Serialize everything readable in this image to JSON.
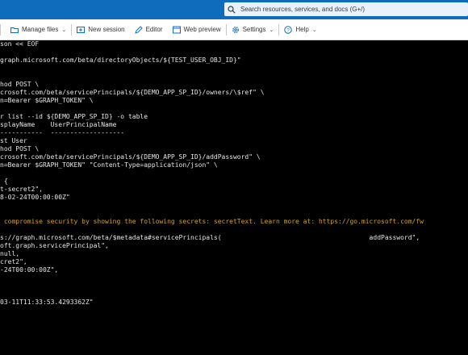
{
  "header": {
    "search_placeholder": "Search resources, services, and docs (G+/)"
  },
  "toolbar": {
    "items": [
      {
        "label": "Manage files",
        "has_dropdown": true,
        "icon": "folder-icon"
      },
      {
        "label": "New session",
        "has_dropdown": false,
        "icon": "new-session-icon"
      },
      {
        "label": "Editor",
        "has_dropdown": false,
        "icon": "editor-icon"
      },
      {
        "label": "Web preview",
        "has_dropdown": false,
        "icon": "web-preview-icon"
      },
      {
        "label": "Settings",
        "has_dropdown": true,
        "icon": "gear-icon"
      },
      {
        "label": "Help",
        "has_dropdown": true,
        "icon": "help-icon"
      }
    ]
  },
  "terminal": {
    "lines": [
      "son << EOF",
      "",
      "graph.microsoft.com/beta/directoryObjects/${TEST_USER_OBJ_ID}\"",
      "",
      "",
      "hod POST \\",
      "crosoft.com/beta/servicePrincipals/${DEMO_APP_SP_ID}/owners/\\$ref\" \\",
      "n=Bearer $GRAPH_TOKEN\" \\",
      "",
      "r list --id ${DEMO_APP_SP_ID} -o table",
      "splayName    UserPrincipalName",
      "-----------  -------------------",
      "st User",
      "hod POST \\",
      "crosoft.com/beta/servicePrincipals/${DEMO_APP_SP_ID}/addPassword\" \\",
      "n=Bearer $GRAPH_TOKEN\" \"Content-Type=application/json\" \\",
      "",
      " {",
      "t-secret2\",",
      "8-02-24T00:00:00Z\"",
      "",
      "",
      " compromise security by showing the following secrets: secretText. Learn more at: https://go.microsoft.com/fw",
      "",
      "s://graph.microsoft.com/beta/$metadata#servicePrincipals(                                      addPassword\",",
      "oft.graph.servicePrincipal\",",
      "null,",
      "cret2\",",
      "-24T00:00:00Z\",",
      "",
      "",
      "",
      "03-11T11:33:53.4293362Z\""
    ],
    "warning_line_index": 22
  },
  "colors": {
    "topbar": "#0f6cbd",
    "terminal_bg": "#000000",
    "terminal_text": "#e6e6e6",
    "warning_text": "#d4a419"
  }
}
